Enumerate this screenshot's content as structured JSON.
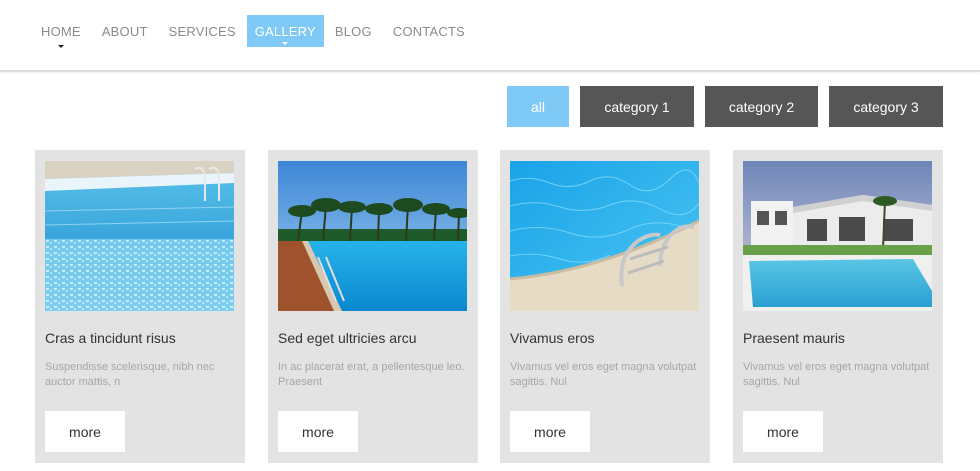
{
  "nav": {
    "items": [
      {
        "label": "HOME",
        "has_dropdown": true,
        "active": false
      },
      {
        "label": "ABOUT",
        "has_dropdown": false,
        "active": false
      },
      {
        "label": "SERVICES",
        "has_dropdown": false,
        "active": false
      },
      {
        "label": "GALLERY",
        "has_dropdown": true,
        "active": true
      },
      {
        "label": "BLOG",
        "has_dropdown": false,
        "active": false
      },
      {
        "label": "CONTACTS",
        "has_dropdown": false,
        "active": false
      }
    ]
  },
  "filters": {
    "items": [
      {
        "label": "all",
        "active": true
      },
      {
        "label": "category 1",
        "active": false
      },
      {
        "label": "category 2",
        "active": false
      },
      {
        "label": "category 3",
        "active": false
      }
    ]
  },
  "gallery": {
    "cards": [
      {
        "image": "pool-tiles-photo",
        "title": "Cras a tincidunt risus",
        "text": "Suspendisse scelerisque, nibh nec auctor mattis, n",
        "more_label": "more"
      },
      {
        "image": "palm-resort-pool-photo",
        "title": "Sed eget ultricies arcu",
        "text": "In ac placerat erat, a pellentesque leo. Praesent",
        "more_label": "more"
      },
      {
        "image": "pool-ladder-photo",
        "title": "Vivamus eros",
        "text": "Vivamus vel eros eget magna volutpat sagittis. Nul",
        "more_label": "more"
      },
      {
        "image": "villa-pool-photo",
        "title": "Praesent mauris",
        "text": "Vivamus vel eros eget magna volutpat sagittis. Nul",
        "more_label": "more"
      }
    ]
  },
  "colors": {
    "accent": "#7ec9f5",
    "filter_inactive": "#565656",
    "card_bg": "#e3e3e3",
    "nav_text": "#8b8b8b"
  }
}
